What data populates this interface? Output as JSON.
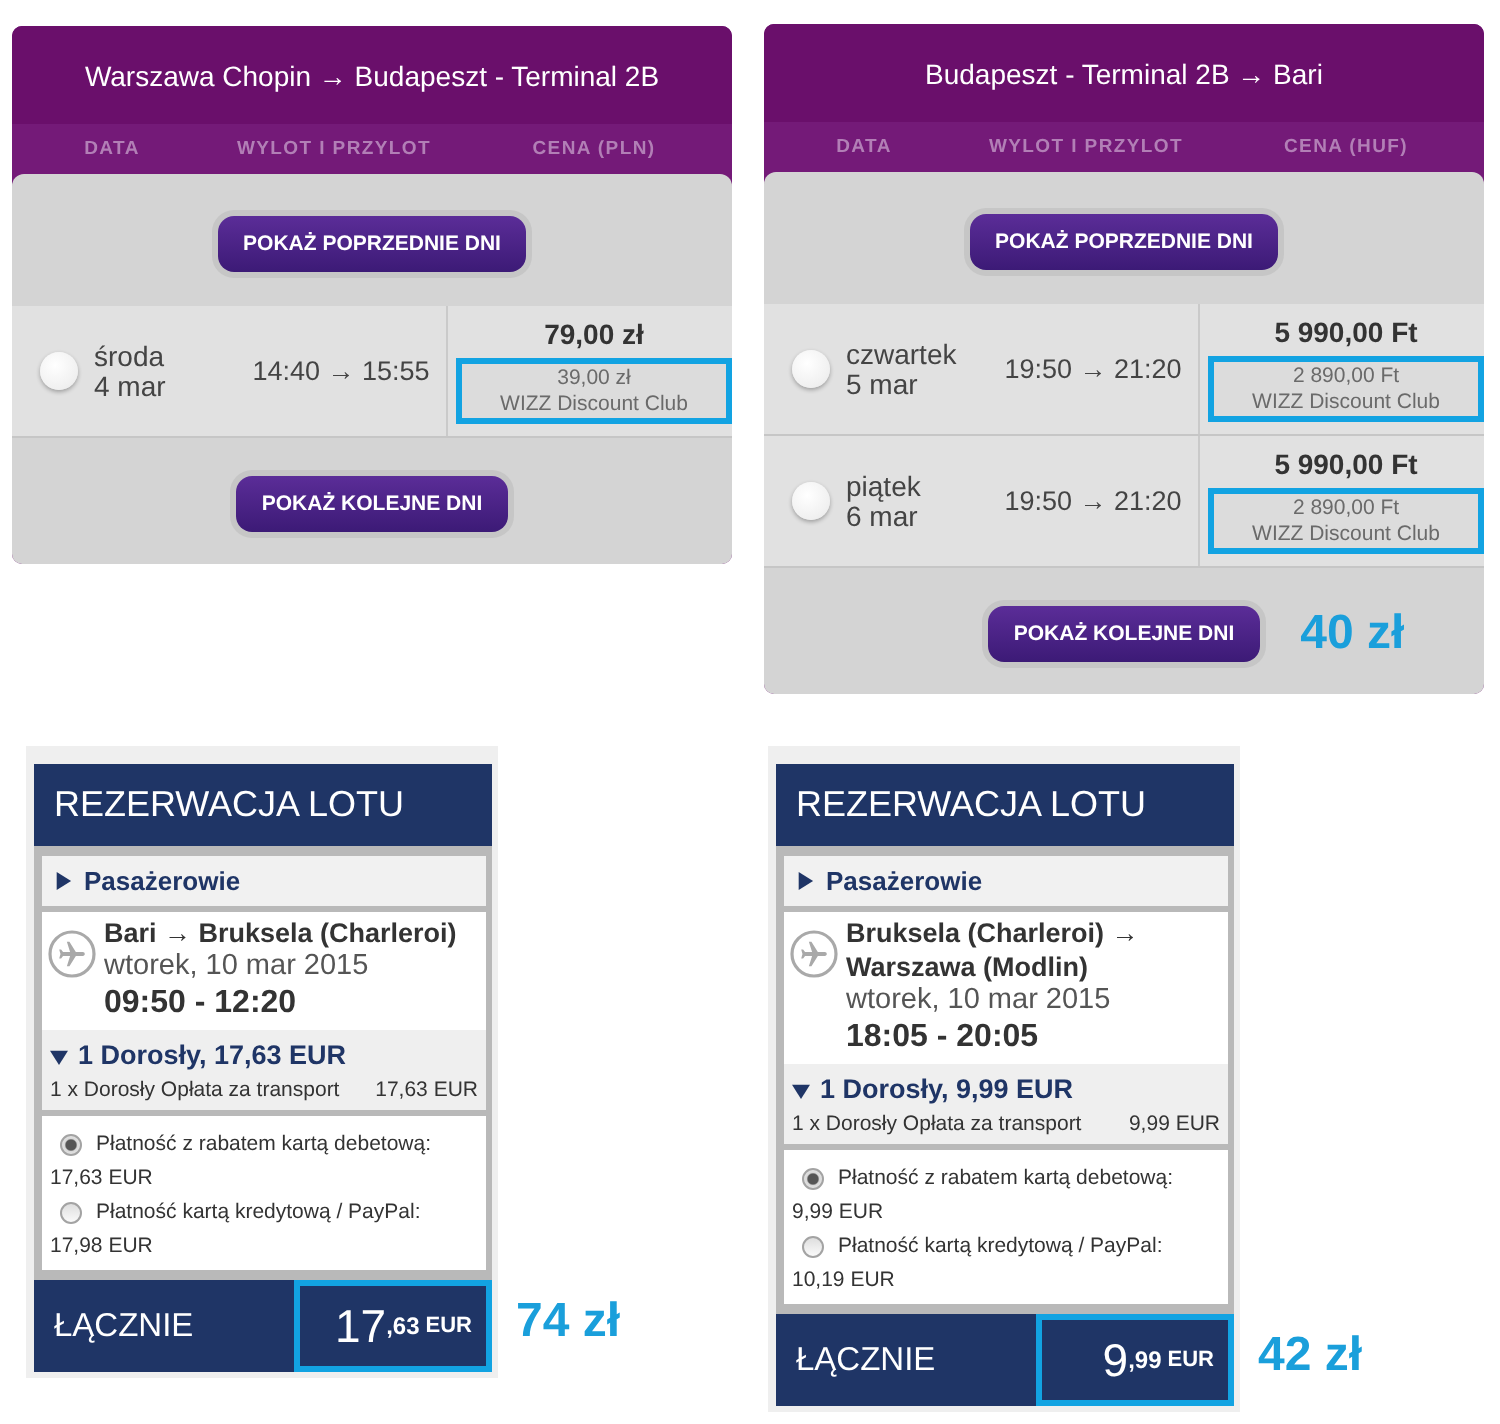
{
  "flight_selectors": [
    {
      "title": "Warszawa Chopin → Budapeszt - Terminal 2B",
      "columns": [
        "DATA",
        "WYLOT I PRZYLOT",
        "CENA (PLN)"
      ],
      "previous_button": "POKAŻ POPRZEDNIE DNI",
      "flights": [
        {
          "day": "środa",
          "date": "4 mar",
          "times": "14:40 → 15:55",
          "price": "79,00 zł",
          "discount_price": "39,00 zł",
          "discount_label": "WIZZ Discount Club",
          "selected": false,
          "highlighted": true
        }
      ],
      "next_button": "POKAŻ KOLEJNE DNI"
    },
    {
      "title": "Budapeszt - Terminal 2B → Bari",
      "columns": [
        "DATA",
        "WYLOT I PRZYLOT",
        "CENA (HUF)"
      ],
      "previous_button": "POKAŻ POPRZEDNIE DNI",
      "flights": [
        {
          "day": "czwartek",
          "date": "5 mar",
          "times": "19:50 → 21:20",
          "price": "5 990,00 Ft",
          "discount_price": "2 890,00 Ft",
          "discount_label": "WIZZ Discount Club",
          "selected": false,
          "highlighted": true
        },
        {
          "day": "piątek",
          "date": "6 mar",
          "times": "19:50 → 21:20",
          "price": "5 990,00 Ft",
          "discount_price": "2 890,00 Ft",
          "discount_label": "WIZZ Discount Club",
          "selected": false,
          "highlighted": true
        }
      ],
      "next_button": "POKAŻ KOLEJNE DNI",
      "annotation": "40 zł"
    }
  ],
  "booking_summaries": [
    {
      "title": "REZERWACJA LOTU",
      "passengers_label": "Pasażerowie",
      "passengers_expanded": false,
      "route": "Bari → Bruksela (Charleroi)",
      "date": "wtorek, 10 mar 2015",
      "times": "09:50 - 12:20",
      "fare_summary": "1 Dorosły, 17,63 EUR",
      "fare_expanded": true,
      "fare_lines": [
        {
          "label": "1 x Dorosły Opłata za transport",
          "amount": "17,63 EUR"
        }
      ],
      "payment_options": [
        {
          "label": "Płatność z rabatem kartą debetową:",
          "amount": "17,63 EUR",
          "selected": true
        },
        {
          "label": "Płatność kartą kredytową / PayPal:",
          "amount": "17,98 EUR",
          "selected": false
        }
      ],
      "total_label": "ŁĄCZNIE",
      "total_whole": "17",
      "total_decimals": ",63",
      "total_currency": "EUR",
      "total_highlighted": true,
      "annotation": "74 zł"
    },
    {
      "title": "REZERWACJA LOTU",
      "passengers_label": "Pasażerowie",
      "passengers_expanded": false,
      "route": "Bruksela (Charleroi) → Warszawa (Modlin)",
      "date": "wtorek, 10 mar 2015",
      "times": "18:05 - 20:05",
      "fare_summary": "1 Dorosły, 9,99 EUR",
      "fare_expanded": true,
      "fare_lines": [
        {
          "label": "1 x Dorosły Opłata za transport",
          "amount": "9,99 EUR"
        }
      ],
      "payment_options": [
        {
          "label": "Płatność z rabatem kartą debetową:",
          "amount": "9,99 EUR",
          "selected": true
        },
        {
          "label": "Płatność kartą kredytową / PayPal:",
          "amount": "10,19 EUR",
          "selected": false
        }
      ],
      "total_label": "ŁĄCZNIE",
      "total_whole": "9",
      "total_decimals": ",99",
      "total_currency": "EUR",
      "total_highlighted": true,
      "annotation": "42 zł"
    }
  ]
}
